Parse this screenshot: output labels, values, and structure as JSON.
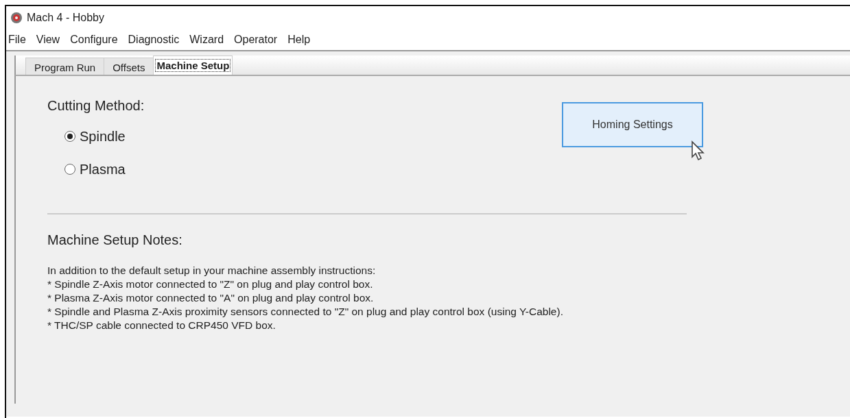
{
  "window": {
    "title": "Mach 4 - Hobby"
  },
  "menu": [
    "File",
    "View",
    "Configure",
    "Diagnostic",
    "Wizard",
    "Operator",
    "Help"
  ],
  "tabs": [
    {
      "label": "Program Run",
      "selected": false
    },
    {
      "label": "Offsets",
      "selected": false
    },
    {
      "label": "Machine Setup",
      "selected": true
    }
  ],
  "cutting_method": {
    "label": "Cutting Method:",
    "options": [
      {
        "label": "Spindle",
        "selected": true
      },
      {
        "label": "Plasma",
        "selected": false
      }
    ]
  },
  "homing_button": {
    "label": "Homing Settings",
    "hovered": true
  },
  "notes": {
    "heading": "Machine Setup Notes:",
    "lines": [
      "In addition to the default setup in your machine assembly instructions:",
      "* Spindle Z-Axis motor connected to \"Z\" on plug and play control box.",
      "* Plasma Z-Axis motor connected to \"A\" on plug and play control box.",
      "* Spindle and Plasma Z-Axis proximity sensors connected to \"Z\" on plug and play control box (using Y-Cable).",
      "* THC/SP cable connected to CRP450 VFD box."
    ]
  }
}
